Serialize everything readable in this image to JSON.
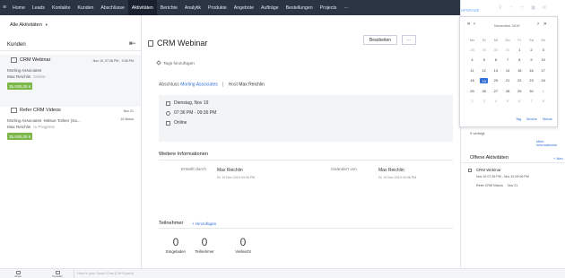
{
  "nav": {
    "tabs": [
      "Home",
      "Leads",
      "Kontakte",
      "Kunden",
      "Abschlüsse",
      "Aktivitäten",
      "Berichte",
      "Analytik",
      "Produkte",
      "Angebote",
      "Aufträge",
      "Bestellungen",
      "Projects",
      "···"
    ],
    "active_index": 5,
    "plan": "Professional",
    "upgrade": "UPGRADE"
  },
  "left": {
    "filter": "Alle Aktivitäten",
    "section_title": "Kunden",
    "cards": [
      {
        "title": "CRM Webinar",
        "time": "Nov 19, 07:36 PM - 9:36 PM",
        "company": "Morling Associates",
        "person": "Max Reichlin",
        "status": "Online",
        "amount": "35.000,00 €"
      },
      {
        "title": "Refer CRM Videos",
        "time": "Nov 21",
        "company": "Morling Associates -Mitsue Tollner (Sa...",
        "time2": "10 Motos",
        "person": "Max Reichlin",
        "status": "In Progress",
        "amount": "35.000,00 €"
      }
    ]
  },
  "main": {
    "title": "CRM Webinar",
    "edit_label": "Bearbeiten",
    "more_label": "···",
    "tag_label": "Tags hinzufügen",
    "assoc_label": "Abschluss",
    "assoc_link": "Morling Associates",
    "host_label": "Host",
    "host_name": "Max Reichlin",
    "date": "Dienstag, Nov 19",
    "time_range": "07:36 PM - 09:36 PM",
    "mode": "Online",
    "more_info_title": "Weitere Informationen",
    "created_by_label": "Erstellt durch",
    "created_by_name": "Max Reichlin",
    "created_by_date": "Di, 19 Nov 2019 04:36 PM",
    "modified_by_label": "Geändert von",
    "modified_by_name": "Max Reichlin",
    "modified_by_date": "Di, 19 Nov 2019 04:36 PM",
    "participants_title": "Teilnehmer",
    "participants_add": "+ Hinzufügen",
    "counts": [
      {
        "n": "0",
        "label": "Eingeladen"
      },
      {
        "n": "0",
        "label": "Teilnehmer"
      },
      {
        "n": "0",
        "label": "Vielleicht"
      }
    ]
  },
  "right": {
    "history": "0 verfolgt",
    "more_info": "Mehr Informationen",
    "open_title": "Offene Aktivitäten",
    "new_label": "+ Neu",
    "items": [
      {
        "title": "CRM Webinar",
        "sub": "Nov 19 07:36 PM  -  Nov 19 09:36 PM"
      },
      {
        "title": "Refer CRM Videos",
        "sub": "Nov 21"
      }
    ]
  },
  "calendar": {
    "month": "November 2019",
    "weekdays": [
      "Mo",
      "Di",
      "Mi",
      "Do",
      "Fr",
      "Sa",
      "So"
    ],
    "weeks": [
      [
        "28",
        "29",
        "30",
        "31",
        "1",
        "2",
        "3"
      ],
      [
        "4",
        "5",
        "6",
        "7",
        "8",
        "9",
        "10"
      ],
      [
        "11",
        "12",
        "13",
        "14",
        "15",
        "16",
        "17"
      ],
      [
        "18",
        "19",
        "20",
        "21",
        "22",
        "23",
        "24"
      ],
      [
        "25",
        "26",
        "27",
        "28",
        "29",
        "30",
        "1"
      ],
      [
        "2",
        "3",
        "4",
        "5",
        "6",
        "7",
        "8"
      ]
    ],
    "selected": "19",
    "footer": [
      "Tag",
      "Woche",
      "Monat"
    ]
  },
  "bottom": {
    "items": [
      "Chats",
      "Kontakte"
    ],
    "search_placeholder": "Here is your Smart Chat (Ctrl+Space)"
  }
}
